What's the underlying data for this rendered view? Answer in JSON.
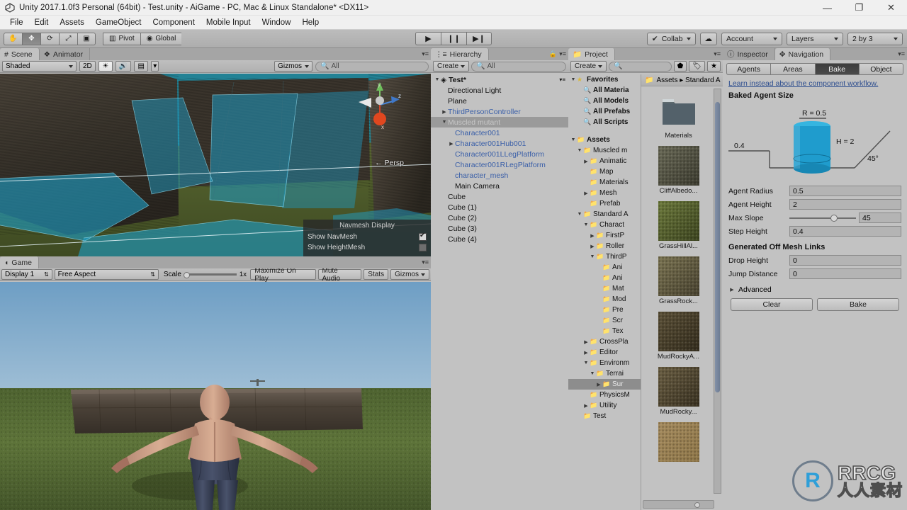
{
  "window": {
    "title": "Unity 2017.1.0f3 Personal (64bit) - Test.unity - AiGame - PC, Mac & Linux Standalone* <DX11>",
    "minimize": "—",
    "maximize": "❐",
    "close": "✕"
  },
  "menu": {
    "items": [
      "File",
      "Edit",
      "Assets",
      "GameObject",
      "Component",
      "Mobile Input",
      "Window",
      "Help"
    ]
  },
  "toolbar": {
    "tools": [
      {
        "name": "hand-tool",
        "glyph": "✋",
        "selected": false
      },
      {
        "name": "move-tool",
        "glyph": "✥",
        "selected": true
      },
      {
        "name": "rotate-tool",
        "glyph": "⟳",
        "selected": false
      },
      {
        "name": "scale-tool",
        "glyph": "⤢",
        "selected": false
      },
      {
        "name": "rect-tool",
        "glyph": "▣",
        "selected": false
      }
    ],
    "pivot": "Pivot",
    "global": "Global",
    "play": "▶",
    "pause": "❙❙",
    "step": "▶❙",
    "collab": "Collab",
    "cloud": "☁",
    "account": "Account",
    "layers": "Layers",
    "layout": "2 by 3"
  },
  "scene": {
    "tabs": [
      {
        "label": "Scene",
        "icon": "grid-icon",
        "active": true
      },
      {
        "label": "Animator",
        "icon": "animator-icon",
        "active": false
      }
    ],
    "shading": "Shaded",
    "mode2d": "2D",
    "lighting": "☀",
    "audio": "🔊",
    "fx": "▤",
    "gizmos": "Gizmos",
    "search_placeholder": "All",
    "persp_label": "← Persp",
    "overlay": {
      "title": "Navmesh Display",
      "rows": [
        {
          "label": "Show NavMesh",
          "checked": true
        },
        {
          "label": "Show HeightMesh",
          "checked": false
        }
      ]
    }
  },
  "game": {
    "tab": "Game",
    "display": "Display 1",
    "aspect": "Free Aspect",
    "scale_label": "Scale",
    "scale_value": "1x",
    "maximize": "Maximize On Play",
    "mute": "Mute Audio",
    "stats": "Stats",
    "gizmos": "Gizmos"
  },
  "hierarchy": {
    "tab": "Hierarchy",
    "create": "Create",
    "search_placeholder": "All",
    "root": "Test*",
    "items": [
      {
        "label": "Directional Light",
        "indent": 1,
        "arrow": false,
        "prefab": false,
        "selected": false
      },
      {
        "label": "Plane",
        "indent": 1,
        "arrow": false,
        "prefab": false,
        "selected": false
      },
      {
        "label": "ThirdPersonController",
        "indent": 1,
        "arrow": true,
        "prefab": true,
        "selected": false
      },
      {
        "label": "Muscled mutant",
        "indent": 1,
        "arrow": true,
        "prefab": false,
        "selected": true
      },
      {
        "label": "Character001",
        "indent": 2,
        "arrow": false,
        "prefab": true,
        "selected": false
      },
      {
        "label": "Character001Hub001",
        "indent": 2,
        "arrow": true,
        "prefab": true,
        "selected": false
      },
      {
        "label": "Character001LLegPlatform",
        "indent": 2,
        "arrow": false,
        "prefab": true,
        "selected": false
      },
      {
        "label": "Character001RLegPlatform",
        "indent": 2,
        "arrow": false,
        "prefab": true,
        "selected": false
      },
      {
        "label": "character_mesh",
        "indent": 2,
        "arrow": false,
        "prefab": true,
        "selected": false
      },
      {
        "label": "Main Camera",
        "indent": 2,
        "arrow": false,
        "prefab": false,
        "selected": false
      },
      {
        "label": "Cube",
        "indent": 1,
        "arrow": false,
        "prefab": false,
        "selected": false
      },
      {
        "label": "Cube (1)",
        "indent": 1,
        "arrow": false,
        "prefab": false,
        "selected": false
      },
      {
        "label": "Cube (2)",
        "indent": 1,
        "arrow": false,
        "prefab": false,
        "selected": false
      },
      {
        "label": "Cube (3)",
        "indent": 1,
        "arrow": false,
        "prefab": false,
        "selected": false
      },
      {
        "label": "Cube (4)",
        "indent": 1,
        "arrow": false,
        "prefab": false,
        "selected": false
      }
    ]
  },
  "project": {
    "tab": "Project",
    "create": "Create",
    "search_placeholder": "",
    "breadcrumb": "Assets ▸ Standard A",
    "tree": [
      {
        "label": "Favorites",
        "indent": 0,
        "arrow": "down",
        "icon": "star",
        "bold": true,
        "selected": false
      },
      {
        "label": "All Materia",
        "indent": 1,
        "arrow": "",
        "icon": "search",
        "bold": true,
        "selected": false
      },
      {
        "label": "All Models",
        "indent": 1,
        "arrow": "",
        "icon": "search",
        "bold": true,
        "selected": false
      },
      {
        "label": "All Prefabs",
        "indent": 1,
        "arrow": "",
        "icon": "search",
        "bold": true,
        "selected": false
      },
      {
        "label": "All Scripts",
        "indent": 1,
        "arrow": "",
        "icon": "search",
        "bold": true,
        "selected": false
      },
      {
        "label": "",
        "indent": 0,
        "arrow": "",
        "icon": "",
        "bold": false,
        "selected": false
      },
      {
        "label": "Assets",
        "indent": 0,
        "arrow": "down",
        "icon": "folder",
        "bold": true,
        "selected": false
      },
      {
        "label": "Muscled m",
        "indent": 1,
        "arrow": "down",
        "icon": "folder",
        "bold": false,
        "selected": false
      },
      {
        "label": "Animatic",
        "indent": 2,
        "arrow": "right",
        "icon": "folder",
        "bold": false,
        "selected": false
      },
      {
        "label": "Map",
        "indent": 2,
        "arrow": "",
        "icon": "folder",
        "bold": false,
        "selected": false
      },
      {
        "label": "Materials",
        "indent": 2,
        "arrow": "",
        "icon": "folder",
        "bold": false,
        "selected": false
      },
      {
        "label": "Mesh",
        "indent": 2,
        "arrow": "right",
        "icon": "folder",
        "bold": false,
        "selected": false
      },
      {
        "label": "Prefab",
        "indent": 2,
        "arrow": "",
        "icon": "folder",
        "bold": false,
        "selected": false
      },
      {
        "label": "Standard A",
        "indent": 1,
        "arrow": "down",
        "icon": "folder",
        "bold": false,
        "selected": false
      },
      {
        "label": "Charact",
        "indent": 2,
        "arrow": "down",
        "icon": "folder",
        "bold": false,
        "selected": false
      },
      {
        "label": "FirstP",
        "indent": 3,
        "arrow": "right",
        "icon": "folder",
        "bold": false,
        "selected": false
      },
      {
        "label": "Roller",
        "indent": 3,
        "arrow": "right",
        "icon": "folder",
        "bold": false,
        "selected": false
      },
      {
        "label": "ThirdP",
        "indent": 3,
        "arrow": "down",
        "icon": "folder",
        "bold": false,
        "selected": false
      },
      {
        "label": "Ani",
        "indent": 4,
        "arrow": "",
        "icon": "folder",
        "bold": false,
        "selected": false
      },
      {
        "label": "Ani",
        "indent": 4,
        "arrow": "",
        "icon": "folder",
        "bold": false,
        "selected": false
      },
      {
        "label": "Mat",
        "indent": 4,
        "arrow": "",
        "icon": "folder",
        "bold": false,
        "selected": false
      },
      {
        "label": "Mod",
        "indent": 4,
        "arrow": "",
        "icon": "folder",
        "bold": false,
        "selected": false
      },
      {
        "label": "Pre",
        "indent": 4,
        "arrow": "",
        "icon": "folder",
        "bold": false,
        "selected": false
      },
      {
        "label": "Scr",
        "indent": 4,
        "arrow": "",
        "icon": "folder",
        "bold": false,
        "selected": false
      },
      {
        "label": "Tex",
        "indent": 4,
        "arrow": "",
        "icon": "folder",
        "bold": false,
        "selected": false
      },
      {
        "label": "CrossPla",
        "indent": 2,
        "arrow": "right",
        "icon": "folder",
        "bold": false,
        "selected": false
      },
      {
        "label": "Editor",
        "indent": 2,
        "arrow": "right",
        "icon": "folder",
        "bold": false,
        "selected": false
      },
      {
        "label": "Environm",
        "indent": 2,
        "arrow": "down",
        "icon": "folder",
        "bold": false,
        "selected": false
      },
      {
        "label": "Terrai",
        "indent": 3,
        "arrow": "down",
        "icon": "folder",
        "bold": false,
        "selected": false
      },
      {
        "label": "Sur",
        "indent": 4,
        "arrow": "right",
        "icon": "folder",
        "bold": false,
        "selected": true
      },
      {
        "label": "PhysicsM",
        "indent": 2,
        "arrow": "",
        "icon": "folder",
        "bold": false,
        "selected": false
      },
      {
        "label": "Utility",
        "indent": 2,
        "arrow": "right",
        "icon": "folder",
        "bold": false,
        "selected": false
      },
      {
        "label": "Test",
        "indent": 1,
        "arrow": "",
        "icon": "folder",
        "bold": false,
        "selected": false
      }
    ],
    "assets": [
      {
        "label": "Materials",
        "kind": "folder"
      },
      {
        "label": "CliffAlbedo...",
        "kind": "texture",
        "color1": "#6a6a57",
        "color2": "#3d3c30"
      },
      {
        "label": "GrassHillAl...",
        "kind": "texture",
        "color1": "#6d7a3c",
        "color2": "#3d4520"
      },
      {
        "label": "GrassRock...",
        "kind": "texture",
        "color1": "#7b7452",
        "color2": "#494330"
      },
      {
        "label": "MudRockyA...",
        "kind": "texture",
        "color1": "#5c5138",
        "color2": "#342d1d"
      },
      {
        "label": "MudRocky...",
        "kind": "texture",
        "color1": "#6b5f43",
        "color2": "#3a3222"
      },
      {
        "label": "",
        "kind": "texture",
        "color1": "#a58b5e",
        "color2": "#8e7648"
      }
    ]
  },
  "inspector": {
    "tabs": [
      {
        "label": "Inspector",
        "icon": "info-icon",
        "active": false
      },
      {
        "label": "Navigation",
        "icon": "navigation-icon",
        "active": true
      }
    ],
    "nav_tabs": [
      {
        "label": "Agents",
        "selected": false
      },
      {
        "label": "Areas",
        "selected": false
      },
      {
        "label": "Bake",
        "selected": true
      },
      {
        "label": "Object",
        "selected": false
      }
    ],
    "learn_link": "Learn instead about the component workflow.",
    "baked_agent_size_header": "Baked Agent Size",
    "diagram": {
      "radius_label": "R = 0.5",
      "height_label": "H = 2",
      "step_label": "0.4",
      "slope_label": "45°"
    },
    "fields": [
      {
        "label": "Agent Radius",
        "value": "0.5",
        "type": "text"
      },
      {
        "label": "Agent Height",
        "value": "2",
        "type": "text"
      },
      {
        "label": "Max Slope",
        "value": "45",
        "type": "slider"
      },
      {
        "label": "Step Height",
        "value": "0.4",
        "type": "text"
      }
    ],
    "offmesh_header": "Generated Off Mesh Links",
    "offmesh_fields": [
      {
        "label": "Drop Height",
        "value": "0",
        "type": "text"
      },
      {
        "label": "Jump Distance",
        "value": "0",
        "type": "text"
      }
    ],
    "advanced": "Advanced",
    "clear_button": "Clear",
    "bake_button": "Bake"
  },
  "watermark": {
    "logo_top": "RRCG",
    "logo_bottom": "人人素材",
    "mark": "R"
  },
  "colors": {
    "panel_bg": "#c2c2c2",
    "toolbar_bg": "#b5b5b5",
    "selection": "#9a9a9a",
    "prefab_blue": "#3a5fa8",
    "accent_cyan": "#2aa9c9",
    "agent_cyan": "#1f9ccd"
  }
}
